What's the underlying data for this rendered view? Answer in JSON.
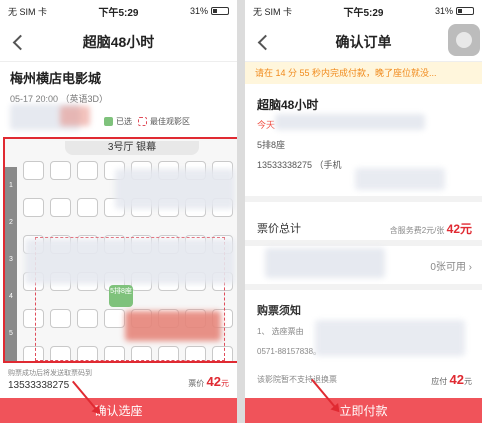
{
  "left": {
    "status": {
      "carrier": "无 SIM 卡",
      "time": "下午5:29",
      "battery": "31%"
    },
    "title": "超脑48小时",
    "cinema": "梅州横店电影城",
    "showtime": "05-17 20:00 （英语3D）",
    "legend": {
      "sold": "已选",
      "best": "最佳观影区"
    },
    "screen_label": "3号厅 银幕",
    "rows": [
      "1",
      "2",
      "3",
      "4",
      "5",
      "6"
    ],
    "selected_seat": "5排8座",
    "ticket_hint": "购票成功后将发送取票码到",
    "phone_number": "13533338275",
    "price_label": "票价",
    "price_value": "42",
    "price_unit": "元",
    "confirm_button": "确认选座"
  },
  "right": {
    "status": {
      "carrier": "无 SIM 卡",
      "time": "下午5:29",
      "battery": "31%"
    },
    "title": "确认订单",
    "timer_text": "请在 14 分 55 秒内完成付款，晚了座位就没...",
    "movie": "超脑48小时",
    "today": "今天",
    "seat": "5排8座",
    "phone": "13533338275 （手机",
    "total_label": "票价总计",
    "fee": "含服务费2元/张",
    "fee_value": "42元",
    "coupon": "0张可用",
    "notice_title": "购票须知",
    "notice_1": "1、 选座票由",
    "notice_2": "0571-88157838。",
    "refund_note": "该影院暂不支持退换票",
    "pay_label": "应付",
    "pay_value": "42",
    "pay_unit": "元",
    "pay_button": "立即付款"
  }
}
